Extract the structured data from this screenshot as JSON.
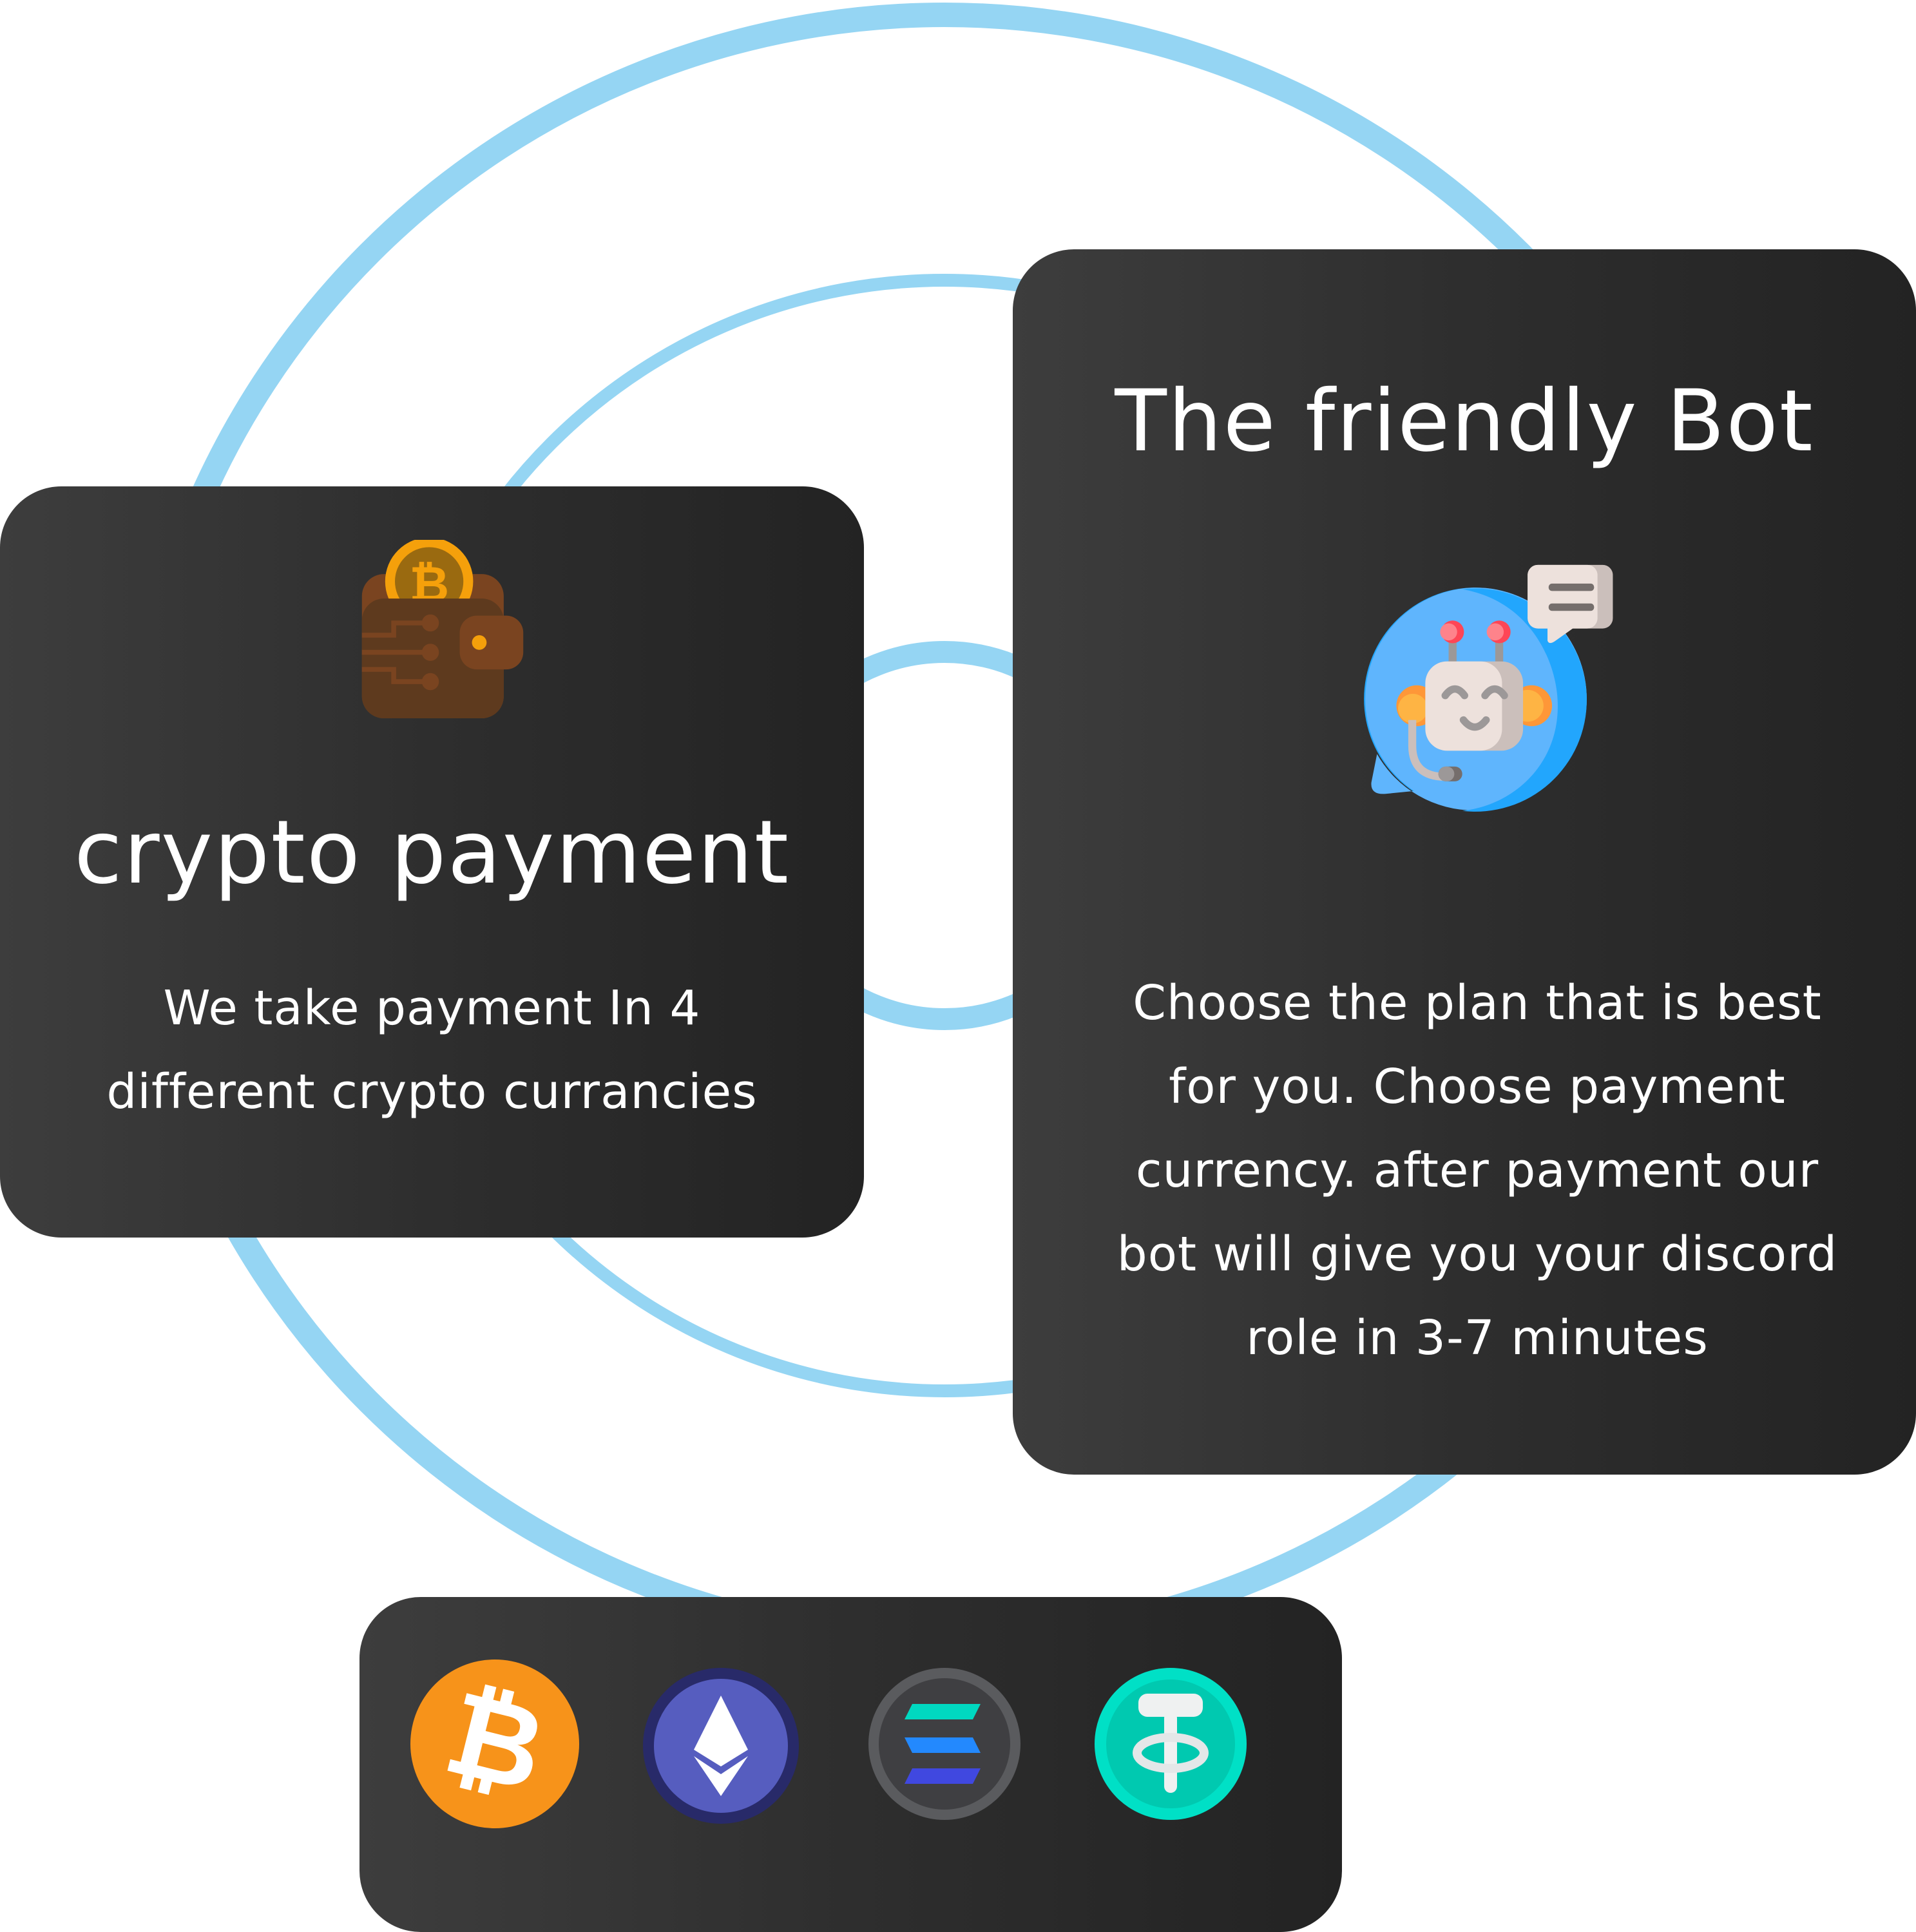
{
  "colors": {
    "ring": "#95d5f3",
    "card_dark": "#2e2e2e",
    "bitcoin": "#f7931a",
    "ethereum": "#565dbf",
    "solana": "#3f3f42",
    "tether": "#00c9b0"
  },
  "crypto_card": {
    "icon": "bitcoin-wallet-icon",
    "title": "crypto payment",
    "body_lines": [
      "We take payment In 4",
      "different crypto currancies"
    ]
  },
  "bot_card": {
    "title": "The friendly Bot",
    "icon": "chat-bot-icon",
    "body_lines": [
      "Choose the plan that is best",
      "for you. Choose payment",
      "currency. after payment our",
      "bot will give you your discord",
      "role in 3-7 minutes"
    ]
  },
  "currencies": [
    {
      "name": "Bitcoin",
      "icon": "bitcoin-icon"
    },
    {
      "name": "Ethereum",
      "icon": "ethereum-icon"
    },
    {
      "name": "Solana",
      "icon": "solana-icon"
    },
    {
      "name": "Tether",
      "icon": "tether-icon"
    }
  ]
}
